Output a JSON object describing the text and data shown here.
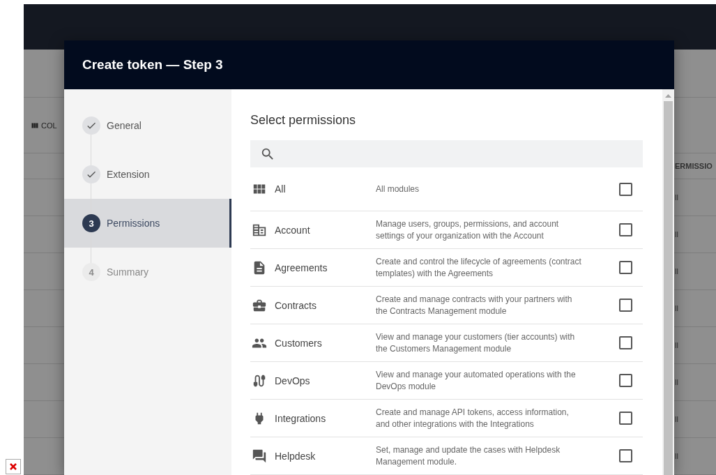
{
  "background": {
    "columns_button": "COL",
    "column_header": "ERMISSIO",
    "rows": [
      {
        "cell": "ll"
      },
      {
        "cell": "ll"
      },
      {
        "cell": "ll"
      },
      {
        "cell": "ll"
      },
      {
        "cell": "ll"
      },
      {
        "cell": "ll"
      },
      {
        "cell": "ll"
      },
      {
        "cell": "ll"
      }
    ]
  },
  "dialog": {
    "title": "Create token — Step 3",
    "steps": [
      {
        "label": "General",
        "kind": "done",
        "selected": false
      },
      {
        "label": "Extension",
        "kind": "done",
        "selected": false
      },
      {
        "label": "Permissions",
        "kind": "active",
        "marker": "3",
        "selected": true
      },
      {
        "label": "Summary",
        "kind": "pending",
        "marker": "4",
        "selected": false
      }
    ],
    "heading": "Select permissions",
    "permissions": [
      {
        "name": "All",
        "description": "All modules",
        "checked": false
      },
      {
        "name": "Account",
        "description": "Manage users, groups, permissions, and account settings of your organization with the Account",
        "checked": false
      },
      {
        "name": "Agreements",
        "description": "Create and control the lifecycle of agreements (contract templates) with the Agreements",
        "checked": false
      },
      {
        "name": "Contracts",
        "description": "Create and manage contracts with your partners with the Contracts Management module",
        "checked": false
      },
      {
        "name": "Customers",
        "description": "View and manage your customers (tier accounts) with the Customers Management module",
        "checked": false
      },
      {
        "name": "DevOps",
        "description": "View and manage your automated operations with the DevOps module",
        "checked": false
      },
      {
        "name": "Integrations",
        "description": "Create and manage API tokens, access information, and other integrations with the Integrations",
        "checked": false
      },
      {
        "name": "Helpdesk",
        "description": "Set, manage and update the cases with Helpdesk Management module.",
        "checked": false
      }
    ]
  }
}
